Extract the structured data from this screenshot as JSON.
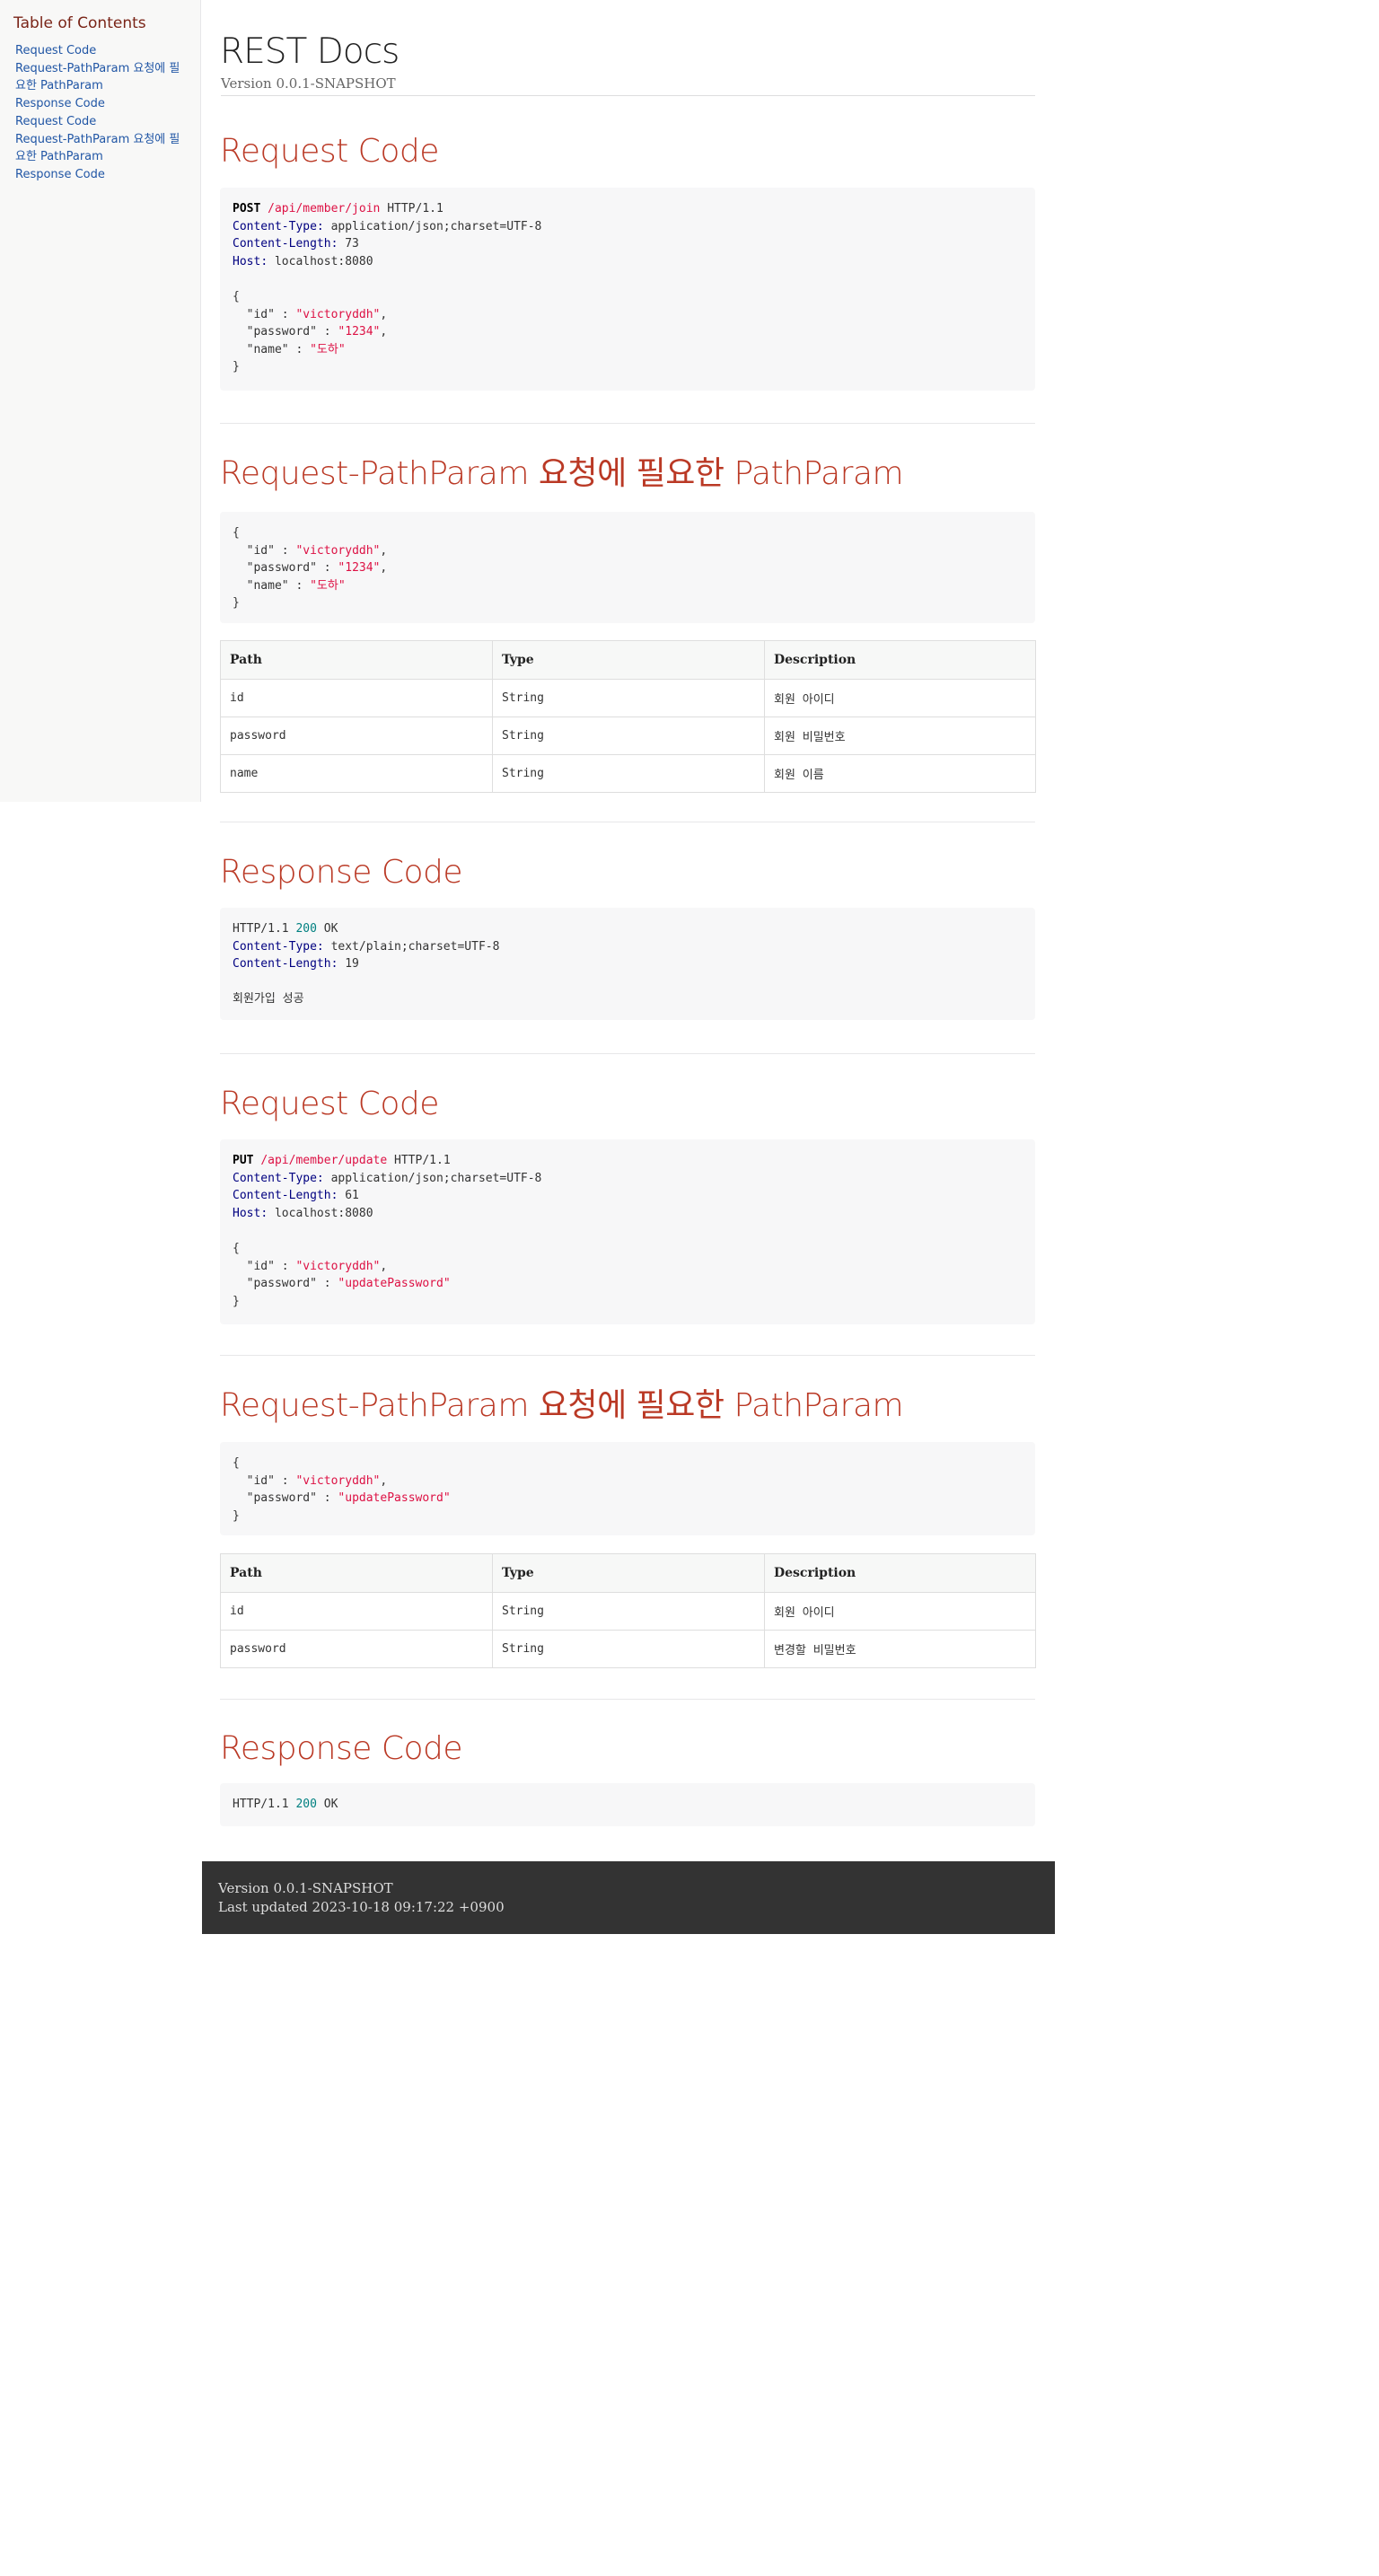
{
  "toc": {
    "title": "Table of Contents",
    "items": [
      "Request Code",
      "Request-PathParam 요청에 필요한 PathParam",
      "Response Code",
      "Request Code",
      "Request-PathParam 요청에 필요한 PathParam",
      "Response Code"
    ]
  },
  "header": {
    "title": "REST Docs",
    "version": "Version 0.0.1-SNAPSHOT"
  },
  "sections": [
    {
      "title": "Request Code",
      "code": {
        "method": "POST",
        "path": "/api/member/join",
        "protocol": "HTTP/1.1",
        "headers": [
          {
            "name": "Content-Type",
            "value": "application/json;charset=UTF-8"
          },
          {
            "name": "Content-Length",
            "value": "73"
          },
          {
            "name": "Host",
            "value": "localhost:8080"
          }
        ],
        "body_fields": [
          {
            "key": "\"id\"",
            "value": "\"victoryddh\""
          },
          {
            "key": "\"password\"",
            "value": "\"1234\""
          },
          {
            "key": "\"name\"",
            "value": "\"도하\""
          }
        ]
      }
    },
    {
      "title": "Request-PathParam 요청에 필요한 PathParam",
      "code": {
        "body_fields": [
          {
            "key": "\"id\"",
            "value": "\"victoryddh\""
          },
          {
            "key": "\"password\"",
            "value": "\"1234\""
          },
          {
            "key": "\"name\"",
            "value": "\"도하\""
          }
        ]
      },
      "table": {
        "columns": [
          "Path",
          "Type",
          "Description"
        ],
        "rows": [
          [
            "id",
            "String",
            "회원 아이디"
          ],
          [
            "password",
            "String",
            "회원 비밀번호"
          ],
          [
            "name",
            "String",
            "회원 이름"
          ]
        ]
      }
    },
    {
      "title": "Response Code",
      "code": {
        "protocol": "HTTP/1.1",
        "status_code": "200",
        "status_text": "OK",
        "headers": [
          {
            "name": "Content-Type",
            "value": "text/plain;charset=UTF-8"
          },
          {
            "name": "Content-Length",
            "value": "19"
          }
        ],
        "body": "회원가입 성공"
      }
    },
    {
      "title": "Request Code",
      "code": {
        "method": "PUT",
        "path": "/api/member/update",
        "protocol": "HTTP/1.1",
        "headers": [
          {
            "name": "Content-Type",
            "value": "application/json;charset=UTF-8"
          },
          {
            "name": "Content-Length",
            "value": "61"
          },
          {
            "name": "Host",
            "value": "localhost:8080"
          }
        ],
        "body_fields": [
          {
            "key": "\"id\"",
            "value": "\"victoryddh\""
          },
          {
            "key": "\"password\"",
            "value": "\"updatePassword\""
          }
        ]
      }
    },
    {
      "title": "Request-PathParam 요청에 필요한 PathParam",
      "code": {
        "body_fields": [
          {
            "key": "\"id\"",
            "value": "\"victoryddh\""
          },
          {
            "key": "\"password\"",
            "value": "\"updatePassword\""
          }
        ]
      },
      "table": {
        "columns": [
          "Path",
          "Type",
          "Description"
        ],
        "rows": [
          [
            "id",
            "String",
            "회원 아이디"
          ],
          [
            "password",
            "String",
            "변경할 비밀번호"
          ]
        ]
      }
    },
    {
      "title": "Response Code",
      "code": {
        "protocol": "HTTP/1.1",
        "status_code": "200",
        "status_text": "OK"
      }
    }
  ],
  "footer": {
    "version": "Version 0.0.1-SNAPSHOT",
    "last_updated": "Last updated 2023-10-18 09:17:22 +0900"
  },
  "colors": {
    "heading": "#ba3925",
    "link": "#2156a5",
    "code_bg": "#f7f7f8",
    "string": "#dd1144",
    "header_key": "#000080",
    "number": "#008080",
    "footer_bg": "#333333"
  }
}
